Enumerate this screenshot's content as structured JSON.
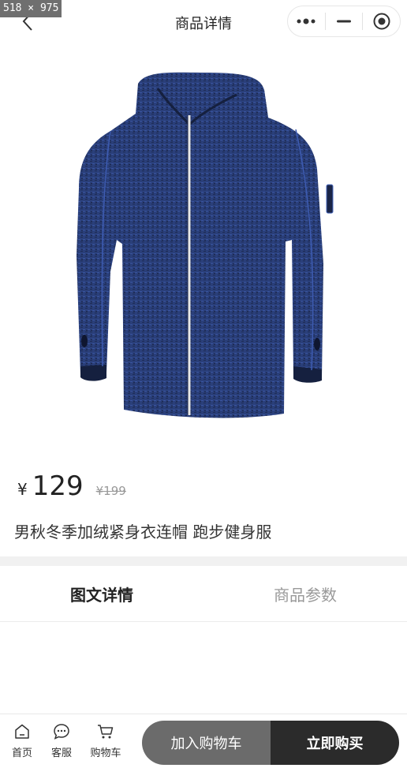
{
  "dimension_badge": "518 × 975",
  "navbar": {
    "title": "商品详情",
    "back_icon": "chevron-left-icon",
    "capsule_icons": [
      "more-dots-icon",
      "minimize-icon",
      "target-circle-icon"
    ]
  },
  "product": {
    "image_icon": "hoodie-jacket-image",
    "currency": "¥",
    "price": "129",
    "original_price": "¥199",
    "title": "男秋冬季加绒紧身衣连帽 跑步健身服"
  },
  "tabs": [
    {
      "label": "图文详情",
      "active": true
    },
    {
      "label": "商品参数",
      "active": false
    }
  ],
  "bottom_bar": {
    "items": [
      {
        "label": "首页",
        "icon": "home-icon"
      },
      {
        "label": "客服",
        "icon": "chat-icon"
      },
      {
        "label": "购物车",
        "icon": "cart-icon"
      }
    ],
    "add_to_cart": "加入购物车",
    "buy_now": "立即购买"
  },
  "colors": {
    "jacket": "#2a3f7a",
    "cart_button": "#6b6b6b",
    "buy_button": "#2b2b2b",
    "divider": "#f1f1f1"
  }
}
